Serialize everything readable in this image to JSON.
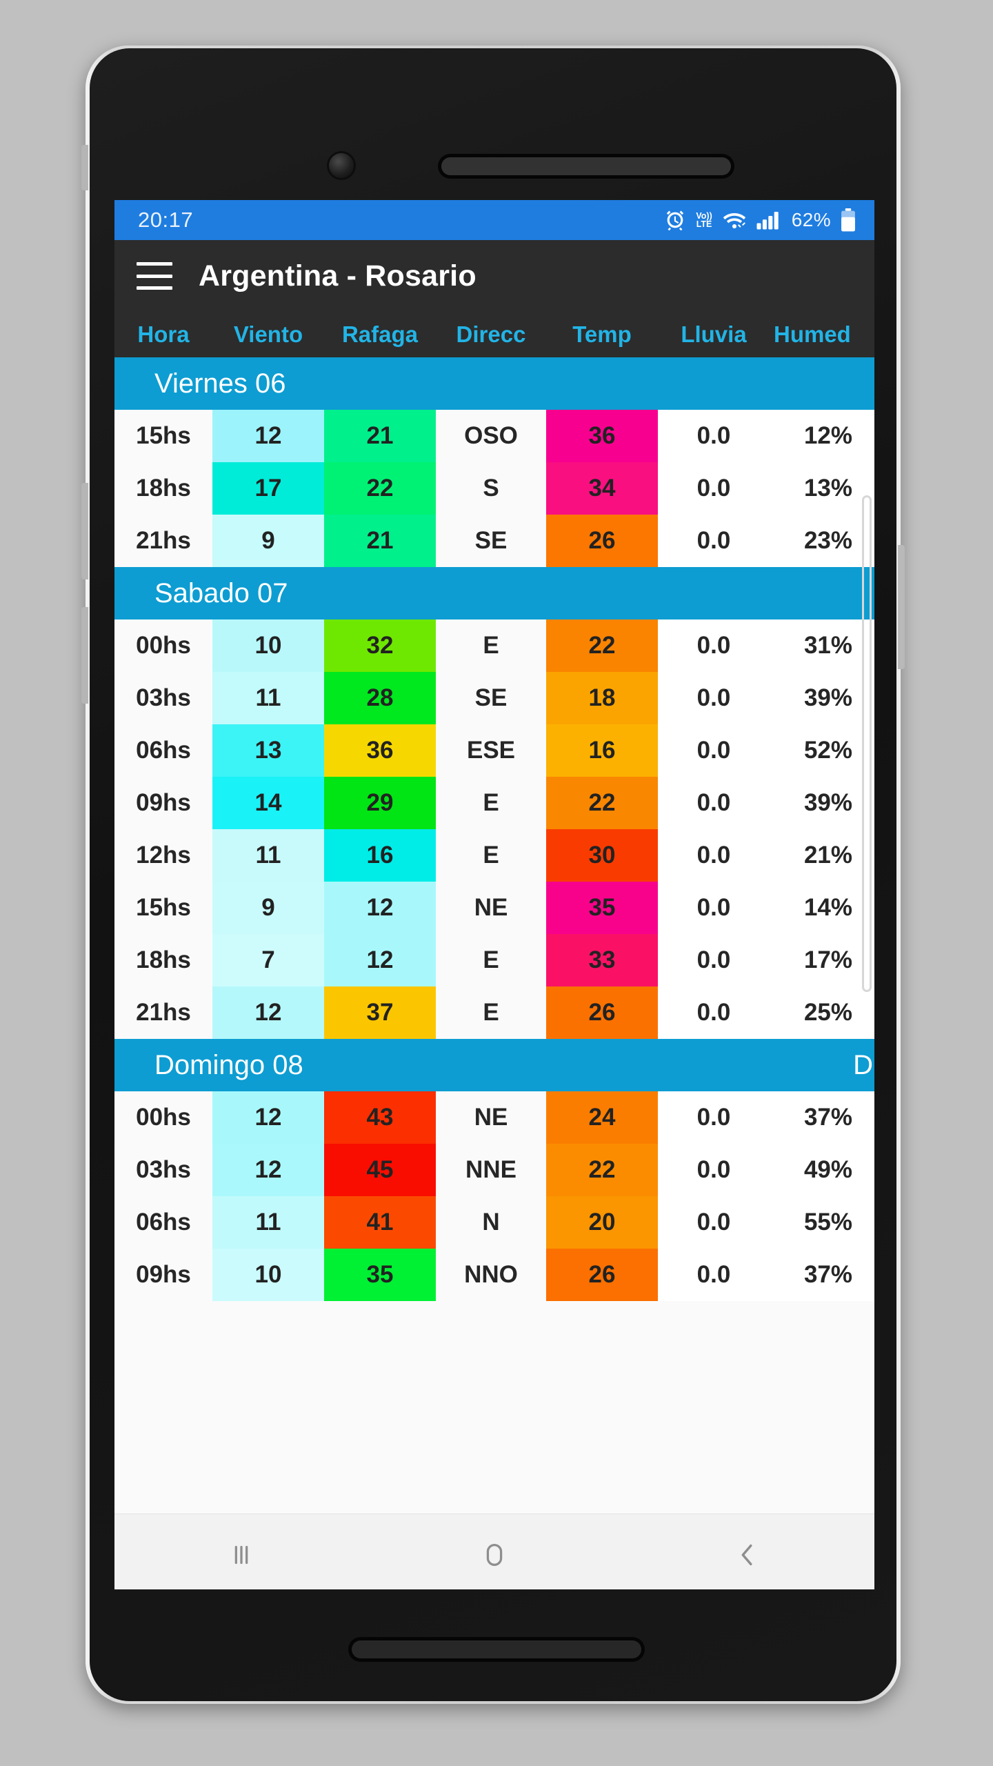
{
  "status_bar": {
    "time": "20:17",
    "battery_percent": "62%",
    "icons": [
      "alarm-icon",
      "volte-icon",
      "wifi-icon",
      "signal-icon",
      "battery-icon"
    ],
    "volte_top": "Vo))",
    "volte_bottom": "LTE",
    "bg_color": "#1f7de0"
  },
  "app_bar": {
    "menu_icon": "hamburger-menu-icon",
    "title": "Argentina - Rosario",
    "bg_color": "#2c2c2c"
  },
  "table": {
    "columns": [
      "Hora",
      "Viento",
      "Rafaga",
      "Direcc",
      "Temp",
      "Lluvia",
      "Humed"
    ],
    "header_color": "#22b4e6",
    "daybar_color": "#0d9dd2",
    "days": [
      {
        "label": "Viernes 06",
        "right_label": "",
        "rows": [
          {
            "hora": "15hs",
            "viento": "12",
            "viento_bg": "#9cf3fb",
            "rafaga": "21",
            "rafaga_bg": "#00f08c",
            "direcc": "OSO",
            "temp": "36",
            "temp_bg": "#f7008f",
            "lluvia": "0.0",
            "humedad": "12%"
          },
          {
            "hora": "18hs",
            "viento": "17",
            "viento_bg": "#00ecd8",
            "rafaga": "22",
            "rafaga_bg": "#00f274",
            "direcc": "S",
            "temp": "34",
            "temp_bg": "#f90f80",
            "lluvia": "0.0",
            "humedad": "13%"
          },
          {
            "hora": "21hs",
            "viento": "9",
            "viento_bg": "#c8fbfb",
            "rafaga": "21",
            "rafaga_bg": "#00f08c",
            "direcc": "SE",
            "temp": "26",
            "temp_bg": "#fb7700",
            "lluvia": "0.0",
            "humedad": "23%"
          }
        ]
      },
      {
        "label": "Sabado 07",
        "right_label": "",
        "rows": [
          {
            "hora": "00hs",
            "viento": "10",
            "viento_bg": "#b8f8fb",
            "rafaga": "32",
            "rafaga_bg": "#6ee800",
            "direcc": "E",
            "temp": "22",
            "temp_bg": "#fa8400",
            "lluvia": "0.0",
            "humedad": "31%"
          },
          {
            "hora": "03hs",
            "viento": "11",
            "viento_bg": "#c3fafc",
            "rafaga": "28",
            "rafaga_bg": "#00e81e",
            "direcc": "SE",
            "temp": "18",
            "temp_bg": "#fba400",
            "lluvia": "0.0",
            "humedad": "39%"
          },
          {
            "hora": "06hs",
            "viento": "13",
            "viento_bg": "#3cf3f6",
            "rafaga": "36",
            "rafaga_bg": "#f6d800",
            "direcc": "ESE",
            "temp": "16",
            "temp_bg": "#fcb100",
            "lluvia": "0.0",
            "humedad": "52%"
          },
          {
            "hora": "09hs",
            "viento": "14",
            "viento_bg": "#19f2f7",
            "rafaga": "29",
            "rafaga_bg": "#00e513",
            "direcc": "E",
            "temp": "22",
            "temp_bg": "#fa8700",
            "lluvia": "0.0",
            "humedad": "39%"
          },
          {
            "hora": "12hs",
            "viento": "11",
            "viento_bg": "#c8fafc",
            "rafaga": "16",
            "rafaga_bg": "#00ece7",
            "direcc": "E",
            "temp": "30",
            "temp_bg": "#fa3b00",
            "lluvia": "0.0",
            "humedad": "21%"
          },
          {
            "hora": "15hs",
            "viento": "9",
            "viento_bg": "#c9fbfd",
            "rafaga": "12",
            "rafaga_bg": "#a8f8fb",
            "direcc": "NE",
            "temp": "35",
            "temp_bg": "#f8028c",
            "lluvia": "0.0",
            "humedad": "14%"
          },
          {
            "hora": "18hs",
            "viento": "7",
            "viento_bg": "#cefcfd",
            "rafaga": "12",
            "rafaga_bg": "#a8f8fb",
            "direcc": "E",
            "temp": "33",
            "temp_bg": "#fa1166",
            "lluvia": "0.0",
            "humedad": "17%"
          },
          {
            "hora": "21hs",
            "viento": "12",
            "viento_bg": "#b5f8fb",
            "rafaga": "37",
            "rafaga_bg": "#fbc600",
            "direcc": "E",
            "temp": "26",
            "temp_bg": "#fb7100",
            "lluvia": "0.0",
            "humedad": "25%"
          }
        ]
      },
      {
        "label": "Domingo 08",
        "right_label": "D",
        "rows": [
          {
            "hora": "00hs",
            "viento": "12",
            "viento_bg": "#a8f8fb",
            "rafaga": "43",
            "rafaga_bg": "#fb2f00",
            "direcc": "NE",
            "temp": "24",
            "temp_bg": "#fb7d00",
            "lluvia": "0.0",
            "humedad": "37%"
          },
          {
            "hora": "03hs",
            "viento": "12",
            "viento_bg": "#aaf8fb",
            "rafaga": "45",
            "rafaga_bg": "#f90d00",
            "direcc": "NNE",
            "temp": "22",
            "temp_bg": "#fb8c00",
            "lluvia": "0.0",
            "humedad": "49%"
          },
          {
            "hora": "06hs",
            "viento": "11",
            "viento_bg": "#c1fafc",
            "rafaga": "41",
            "rafaga_bg": "#fb4a00",
            "direcc": "N",
            "temp": "20",
            "temp_bg": "#fb9500",
            "lluvia": "0.0",
            "humedad": "55%"
          },
          {
            "hora": "09hs",
            "viento": "10",
            "viento_bg": "#cbfbfd",
            "rafaga": "35",
            "rafaga_bg": "#00f033",
            "direcc": "NNO",
            "temp": "26",
            "temp_bg": "#fb7000",
            "lluvia": "0.0",
            "humedad": "37%"
          }
        ]
      }
    ]
  },
  "nav_bar": {
    "recents_icon": "recents-icon",
    "home_icon": "home-icon",
    "back_icon": "back-icon"
  }
}
